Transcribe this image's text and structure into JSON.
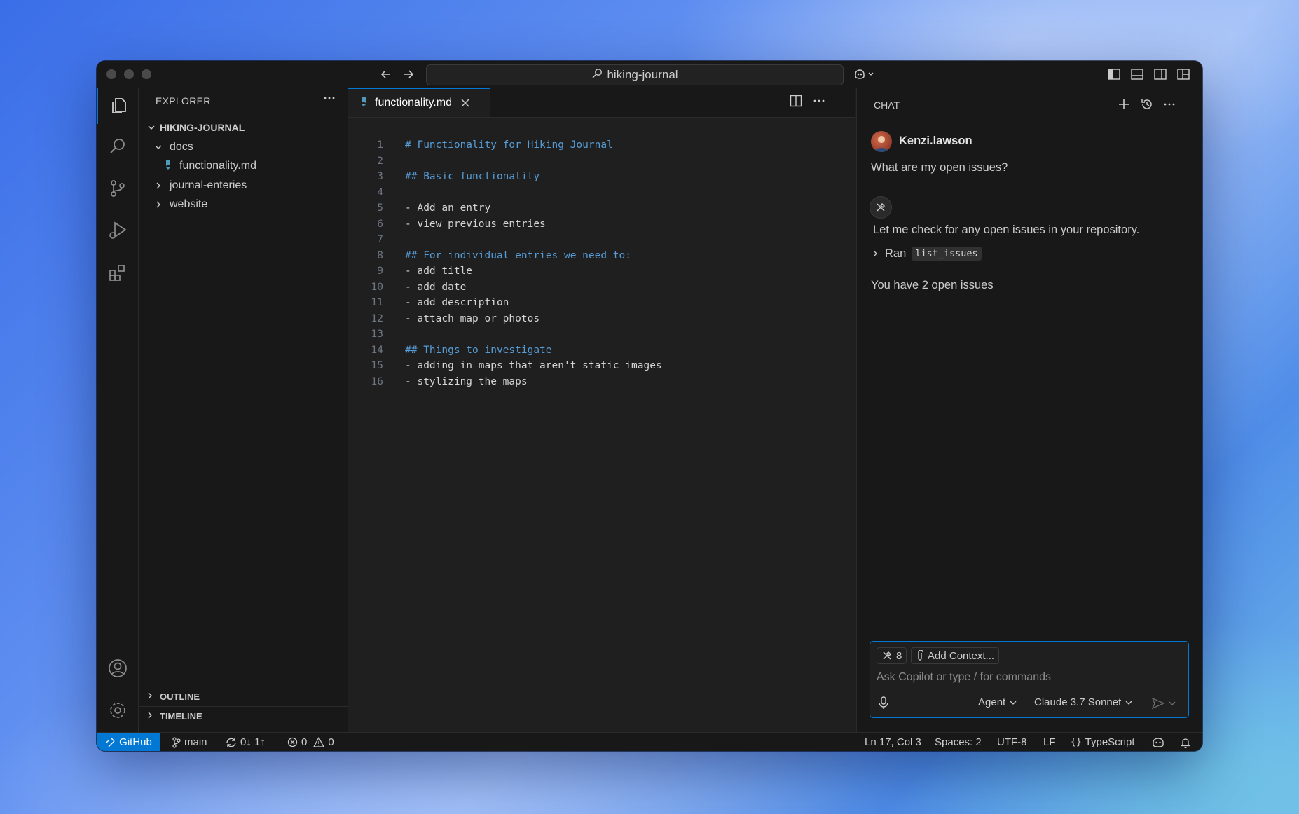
{
  "titlebar": {
    "search_text": "hiking-journal"
  },
  "sidebar": {
    "header": "EXPLORER",
    "root": "HIKING-JOURNAL",
    "tree": [
      {
        "label": "docs"
      },
      {
        "label": "functionality.md"
      },
      {
        "label": "journal-enteries"
      },
      {
        "label": "website"
      }
    ],
    "outline": "OUTLINE",
    "timeline": "TIMELINE"
  },
  "editor": {
    "tab_label": "functionality.md",
    "lines": [
      {
        "num": "1",
        "text": "# Functionality for Hiking Journal"
      },
      {
        "num": "2",
        "text": ""
      },
      {
        "num": "3",
        "text": "## Basic functionality"
      },
      {
        "num": "4",
        "text": ""
      },
      {
        "num": "5",
        "text": "- Add an entry"
      },
      {
        "num": "6",
        "text": "- view previous entries"
      },
      {
        "num": "7",
        "text": ""
      },
      {
        "num": "8",
        "text": "## For individual entries we need to:"
      },
      {
        "num": "9",
        "text": "- add title"
      },
      {
        "num": "10",
        "text": "- add date"
      },
      {
        "num": "11",
        "text": "- add description"
      },
      {
        "num": "12",
        "text": "- attach map or photos"
      },
      {
        "num": "13",
        "text": ""
      },
      {
        "num": "14",
        "text": "## Things to investigate"
      },
      {
        "num": "15",
        "text": "- adding in maps that aren't static images"
      },
      {
        "num": "16",
        "text": "- stylizing the maps"
      }
    ]
  },
  "chat": {
    "title": "CHAT",
    "user_name": "Kenzi.lawson",
    "user_message": "What are my open issues?",
    "assistant_message": "Let me check for any open issues in your repository.",
    "ran_label": "Ran",
    "ran_tool": "list_issues",
    "result_message": "You have 2 open issues",
    "tools_count": "8",
    "add_context_label": "Add Context...",
    "input_placeholder": "Ask Copilot or type / for commands",
    "mode_label": "Agent",
    "model_label": "Claude 3.7 Sonnet"
  },
  "statusbar": {
    "remote_label": "GitHub",
    "branch": "main",
    "sync": "0↓ 1↑",
    "errors": "0",
    "warnings": "0",
    "cursor": "Ln 17, Col 3",
    "spaces": "Spaces: 2",
    "encoding": "UTF-8",
    "eol": "LF",
    "language": "TypeScript"
  },
  "colors": {
    "accent": "#0078d4",
    "heading": "#569cd6",
    "background": "#1f1f1f"
  },
  "icons": [
    "files-icon",
    "search-icon",
    "source-control-icon",
    "run-debug-icon",
    "extensions-icon",
    "account-icon",
    "settings-gear-icon",
    "copilot-icon",
    "bell-icon"
  ]
}
